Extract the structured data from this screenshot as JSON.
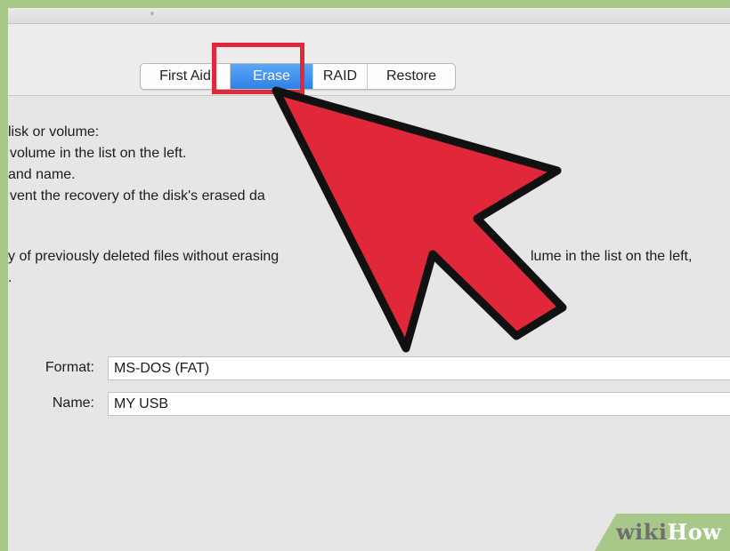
{
  "tabs": [
    {
      "label": "First Aid",
      "selected": false
    },
    {
      "label": "Erase",
      "selected": true
    },
    {
      "label": "RAID",
      "selected": false
    },
    {
      "label": "Restore",
      "selected": false
    }
  ],
  "instructions": [
    "lisk or volume:",
    "volume in the list on the left.",
    "and name.",
    "vent the recovery of the disk's erased da",
    "y of previously deleted files without erasing",
    "lume in the list on the left,"
  ],
  "form": {
    "format_label": "Format:",
    "format_value": "MS-DOS (FAT)",
    "name_label": "Name:",
    "name_value": "MY USB"
  },
  "watermark": {
    "part1": "wiki",
    "part2": "How"
  },
  "colors": {
    "accent_tab": "#2f80e6",
    "highlight": "#e0283a",
    "arrow": "#e0283a",
    "background_green": "#a8c88a"
  }
}
